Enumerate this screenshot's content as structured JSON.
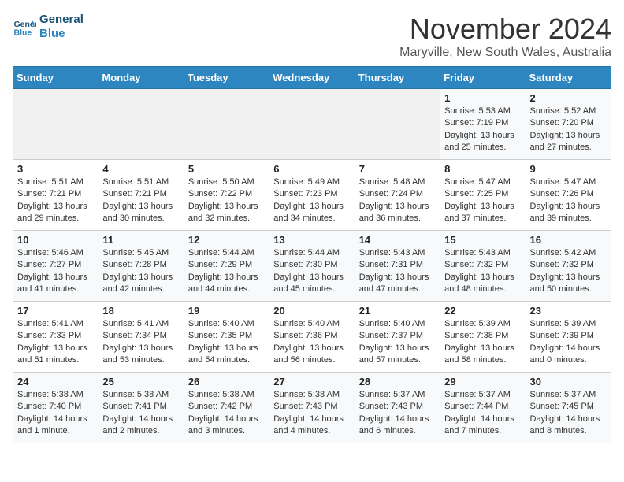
{
  "logo": {
    "line1": "General",
    "line2": "Blue"
  },
  "title": "November 2024",
  "subtitle": "Maryville, New South Wales, Australia",
  "days_of_week": [
    "Sunday",
    "Monday",
    "Tuesday",
    "Wednesday",
    "Thursday",
    "Friday",
    "Saturday"
  ],
  "weeks": [
    [
      {
        "day": "",
        "info": ""
      },
      {
        "day": "",
        "info": ""
      },
      {
        "day": "",
        "info": ""
      },
      {
        "day": "",
        "info": ""
      },
      {
        "day": "",
        "info": ""
      },
      {
        "day": "1",
        "info": "Sunrise: 5:53 AM\nSunset: 7:19 PM\nDaylight: 13 hours\nand 25 minutes."
      },
      {
        "day": "2",
        "info": "Sunrise: 5:52 AM\nSunset: 7:20 PM\nDaylight: 13 hours\nand 27 minutes."
      }
    ],
    [
      {
        "day": "3",
        "info": "Sunrise: 5:51 AM\nSunset: 7:21 PM\nDaylight: 13 hours\nand 29 minutes."
      },
      {
        "day": "4",
        "info": "Sunrise: 5:51 AM\nSunset: 7:21 PM\nDaylight: 13 hours\nand 30 minutes."
      },
      {
        "day": "5",
        "info": "Sunrise: 5:50 AM\nSunset: 7:22 PM\nDaylight: 13 hours\nand 32 minutes."
      },
      {
        "day": "6",
        "info": "Sunrise: 5:49 AM\nSunset: 7:23 PM\nDaylight: 13 hours\nand 34 minutes."
      },
      {
        "day": "7",
        "info": "Sunrise: 5:48 AM\nSunset: 7:24 PM\nDaylight: 13 hours\nand 36 minutes."
      },
      {
        "day": "8",
        "info": "Sunrise: 5:47 AM\nSunset: 7:25 PM\nDaylight: 13 hours\nand 37 minutes."
      },
      {
        "day": "9",
        "info": "Sunrise: 5:47 AM\nSunset: 7:26 PM\nDaylight: 13 hours\nand 39 minutes."
      }
    ],
    [
      {
        "day": "10",
        "info": "Sunrise: 5:46 AM\nSunset: 7:27 PM\nDaylight: 13 hours\nand 41 minutes."
      },
      {
        "day": "11",
        "info": "Sunrise: 5:45 AM\nSunset: 7:28 PM\nDaylight: 13 hours\nand 42 minutes."
      },
      {
        "day": "12",
        "info": "Sunrise: 5:44 AM\nSunset: 7:29 PM\nDaylight: 13 hours\nand 44 minutes."
      },
      {
        "day": "13",
        "info": "Sunrise: 5:44 AM\nSunset: 7:30 PM\nDaylight: 13 hours\nand 45 minutes."
      },
      {
        "day": "14",
        "info": "Sunrise: 5:43 AM\nSunset: 7:31 PM\nDaylight: 13 hours\nand 47 minutes."
      },
      {
        "day": "15",
        "info": "Sunrise: 5:43 AM\nSunset: 7:32 PM\nDaylight: 13 hours\nand 48 minutes."
      },
      {
        "day": "16",
        "info": "Sunrise: 5:42 AM\nSunset: 7:32 PM\nDaylight: 13 hours\nand 50 minutes."
      }
    ],
    [
      {
        "day": "17",
        "info": "Sunrise: 5:41 AM\nSunset: 7:33 PM\nDaylight: 13 hours\nand 51 minutes."
      },
      {
        "day": "18",
        "info": "Sunrise: 5:41 AM\nSunset: 7:34 PM\nDaylight: 13 hours\nand 53 minutes."
      },
      {
        "day": "19",
        "info": "Sunrise: 5:40 AM\nSunset: 7:35 PM\nDaylight: 13 hours\nand 54 minutes."
      },
      {
        "day": "20",
        "info": "Sunrise: 5:40 AM\nSunset: 7:36 PM\nDaylight: 13 hours\nand 56 minutes."
      },
      {
        "day": "21",
        "info": "Sunrise: 5:40 AM\nSunset: 7:37 PM\nDaylight: 13 hours\nand 57 minutes."
      },
      {
        "day": "22",
        "info": "Sunrise: 5:39 AM\nSunset: 7:38 PM\nDaylight: 13 hours\nand 58 minutes."
      },
      {
        "day": "23",
        "info": "Sunrise: 5:39 AM\nSunset: 7:39 PM\nDaylight: 14 hours\nand 0 minutes."
      }
    ],
    [
      {
        "day": "24",
        "info": "Sunrise: 5:38 AM\nSunset: 7:40 PM\nDaylight: 14 hours\nand 1 minute."
      },
      {
        "day": "25",
        "info": "Sunrise: 5:38 AM\nSunset: 7:41 PM\nDaylight: 14 hours\nand 2 minutes."
      },
      {
        "day": "26",
        "info": "Sunrise: 5:38 AM\nSunset: 7:42 PM\nDaylight: 14 hours\nand 3 minutes."
      },
      {
        "day": "27",
        "info": "Sunrise: 5:38 AM\nSunset: 7:43 PM\nDaylight: 14 hours\nand 4 minutes."
      },
      {
        "day": "28",
        "info": "Sunrise: 5:37 AM\nSunset: 7:43 PM\nDaylight: 14 hours\nand 6 minutes."
      },
      {
        "day": "29",
        "info": "Sunrise: 5:37 AM\nSunset: 7:44 PM\nDaylight: 14 hours\nand 7 minutes."
      },
      {
        "day": "30",
        "info": "Sunrise: 5:37 AM\nSunset: 7:45 PM\nDaylight: 14 hours\nand 8 minutes."
      }
    ]
  ]
}
